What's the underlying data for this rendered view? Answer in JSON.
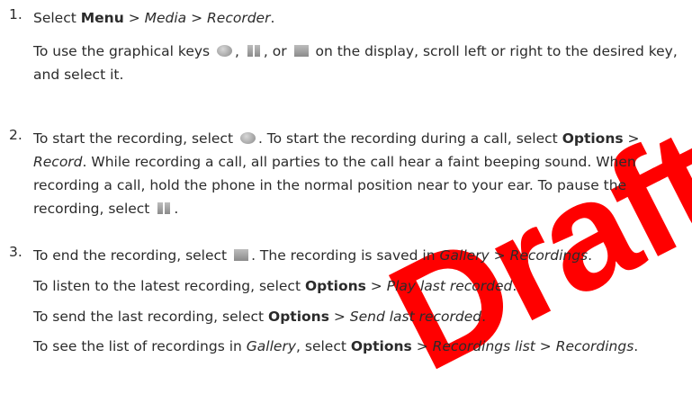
{
  "watermark": "Draft",
  "steps": [
    {
      "number": "1.",
      "line1": {
        "t1": "Select ",
        "b1": "Menu",
        "t2": " > ",
        "i1": "Media",
        "t3": " > ",
        "i2": "Recorder",
        "t4": "."
      },
      "line2": {
        "t1": "To use the graphical keys ",
        "t2": ", ",
        "t3": ", or ",
        "t4": " on the display, scroll left or right to the desired key, and select it."
      }
    },
    {
      "number": "2.",
      "p": {
        "t1": "To start the recording, select ",
        "t2": ". To start the recording during a call, select ",
        "b1": "Options",
        "t3": " > ",
        "i1": "Record",
        "t4": ". While recording a call, all parties to the call hear a faint beeping sound. When recording a call, hold the phone in the normal position near to your ear. To pause the recording, select ",
        "t5": "."
      }
    },
    {
      "number": "3.",
      "p1": {
        "t1": "To end the recording, select ",
        "t2": ". The recording is saved in ",
        "i1": "Gallery",
        "t3": " > ",
        "i2": "Recordings",
        "t4": "."
      },
      "p2": {
        "t1": "To listen to the latest recording, select ",
        "b1": "Options",
        "t2": " > ",
        "i1": "Play last recorded",
        "t3": "."
      },
      "p3": {
        "t1": "To send the last recording, select ",
        "b1": "Options",
        "t2": " > ",
        "i1": "Send last recorded",
        "t3": "."
      },
      "p4": {
        "t1": "To see the list of recordings in ",
        "i1": "Gallery",
        "t2": ", select ",
        "b1": "Options",
        "t3": " > ",
        "i2": "Recordings list",
        "t4": " > ",
        "i3": "Recordings",
        "t5": "."
      }
    }
  ],
  "icons": {
    "record": "record-key-icon",
    "pause": "pause-key-icon",
    "stop": "stop-key-icon"
  }
}
